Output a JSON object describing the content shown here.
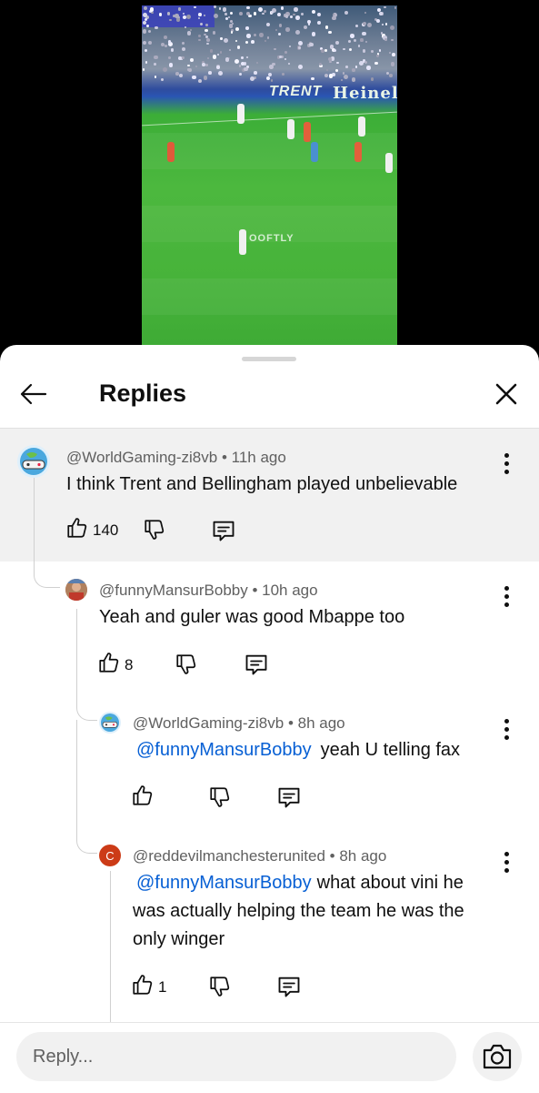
{
  "video": {
    "ad_text_1": "TRENT",
    "ad_text_2": "Heinel",
    "watermark": "OOFTLY"
  },
  "header": {
    "title": "Replies"
  },
  "comments": [
    {
      "author": "@WorldGaming-zi8vb",
      "time": "11h ago",
      "text": "I think Trent and Bellingham played unbelievable",
      "likes": "140",
      "avatar_icon": "globe-controller-avatar"
    },
    {
      "author": "@funnyMansurBobby",
      "time": "10h ago",
      "text": "Yeah and guler was good Mbappe too",
      "likes": "8",
      "avatar_icon": "photo-avatar"
    },
    {
      "author": "@WorldGaming-zi8vb",
      "time": "8h ago",
      "mention": "@funnyMansurBobby",
      "text": "yeah U telling fax",
      "likes": "",
      "avatar_icon": "globe-controller-avatar"
    },
    {
      "author": "@reddevilmanchesterunited",
      "time": "8h ago",
      "mention": "@funnyMansurBobby",
      "text": "what about vini he was actually helping the team he was the only winger",
      "likes": "1",
      "avatar_letter": "C",
      "avatar_color": "#cc3b17"
    }
  ],
  "footer": {
    "reply_placeholder": "Reply..."
  },
  "colors": {
    "mention": "#065fd4",
    "highlight_bg": "#f1f1f1"
  }
}
